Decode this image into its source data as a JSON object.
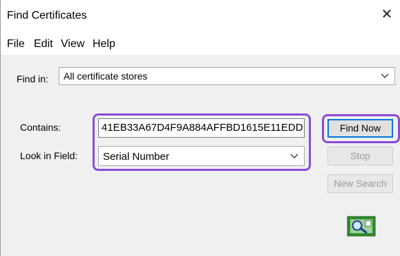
{
  "window": {
    "title": "Find Certificates",
    "close_glyph": "✕"
  },
  "menu": [
    "File",
    "Edit",
    "View",
    "Help"
  ],
  "find_in": {
    "label": "Find in:",
    "value": "All certificate stores"
  },
  "contains": {
    "label": "Contains:",
    "value": "41EB33A67D4F9A884AFFBD1615E11EDD"
  },
  "look_in_field": {
    "label": "Look in Field:",
    "value": "Serial Number"
  },
  "buttons": {
    "find_now": "Find Now",
    "stop": "Stop",
    "new_search": "New Search"
  },
  "colors": {
    "highlight": "#8a4bd6",
    "default_button_border": "#0078d7"
  },
  "icons": {
    "search_image": "magnifier-certificate-icon",
    "close": "close-icon",
    "dropdown": "chevron-down-icon"
  }
}
